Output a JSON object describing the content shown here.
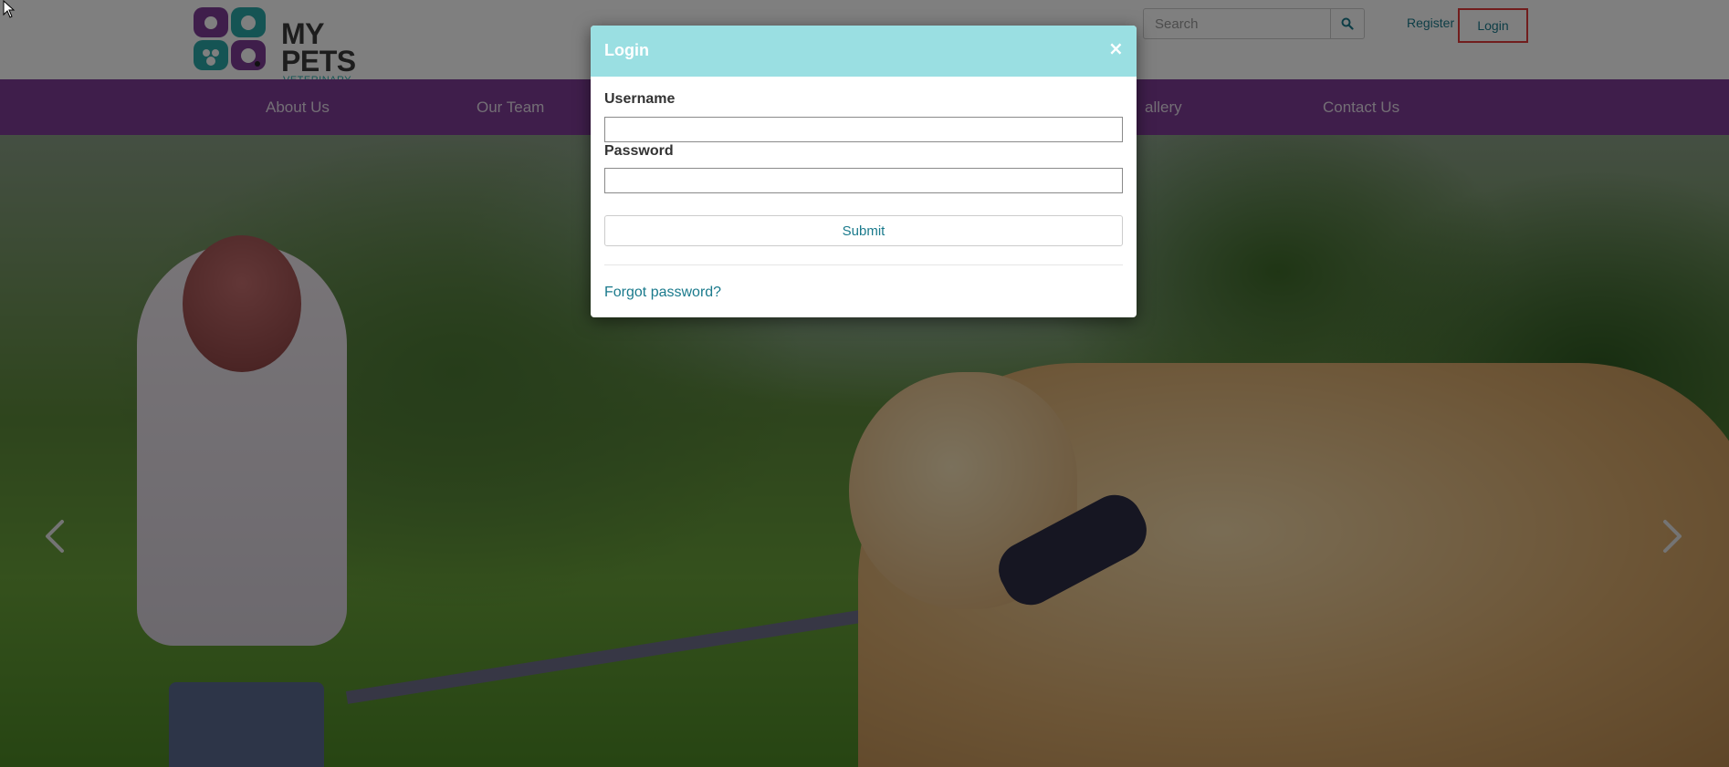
{
  "brand": {
    "title": "MY PETS",
    "subtitle": "VETERINARY CENTER",
    "colors": {
      "purple": "#7e3c96",
      "teal": "#2aa9a9",
      "dark": "#3a3a3a"
    }
  },
  "header": {
    "search": {
      "placeholder": "Search",
      "icon": "search-icon"
    },
    "register_label": "Register",
    "login_label": "Login",
    "highlight_color": "#e23b3b"
  },
  "nav": {
    "items": [
      {
        "label": "About Us"
      },
      {
        "label": "Our Team"
      },
      {
        "label": "allery"
      },
      {
        "label": "Contact Us"
      }
    ],
    "background": "#7e3c96"
  },
  "carousel": {
    "prev_icon": "chevron-left-icon",
    "next_icon": "chevron-right-icon"
  },
  "modal": {
    "title": "Login",
    "close_symbol": "×",
    "header_color": "#9adfe2",
    "username_label": "Username",
    "username_value": "",
    "password_label": "Password",
    "password_value": "",
    "submit_label": "Submit",
    "forgot_label": "Forgot password?",
    "link_color": "#1a7a8c"
  }
}
